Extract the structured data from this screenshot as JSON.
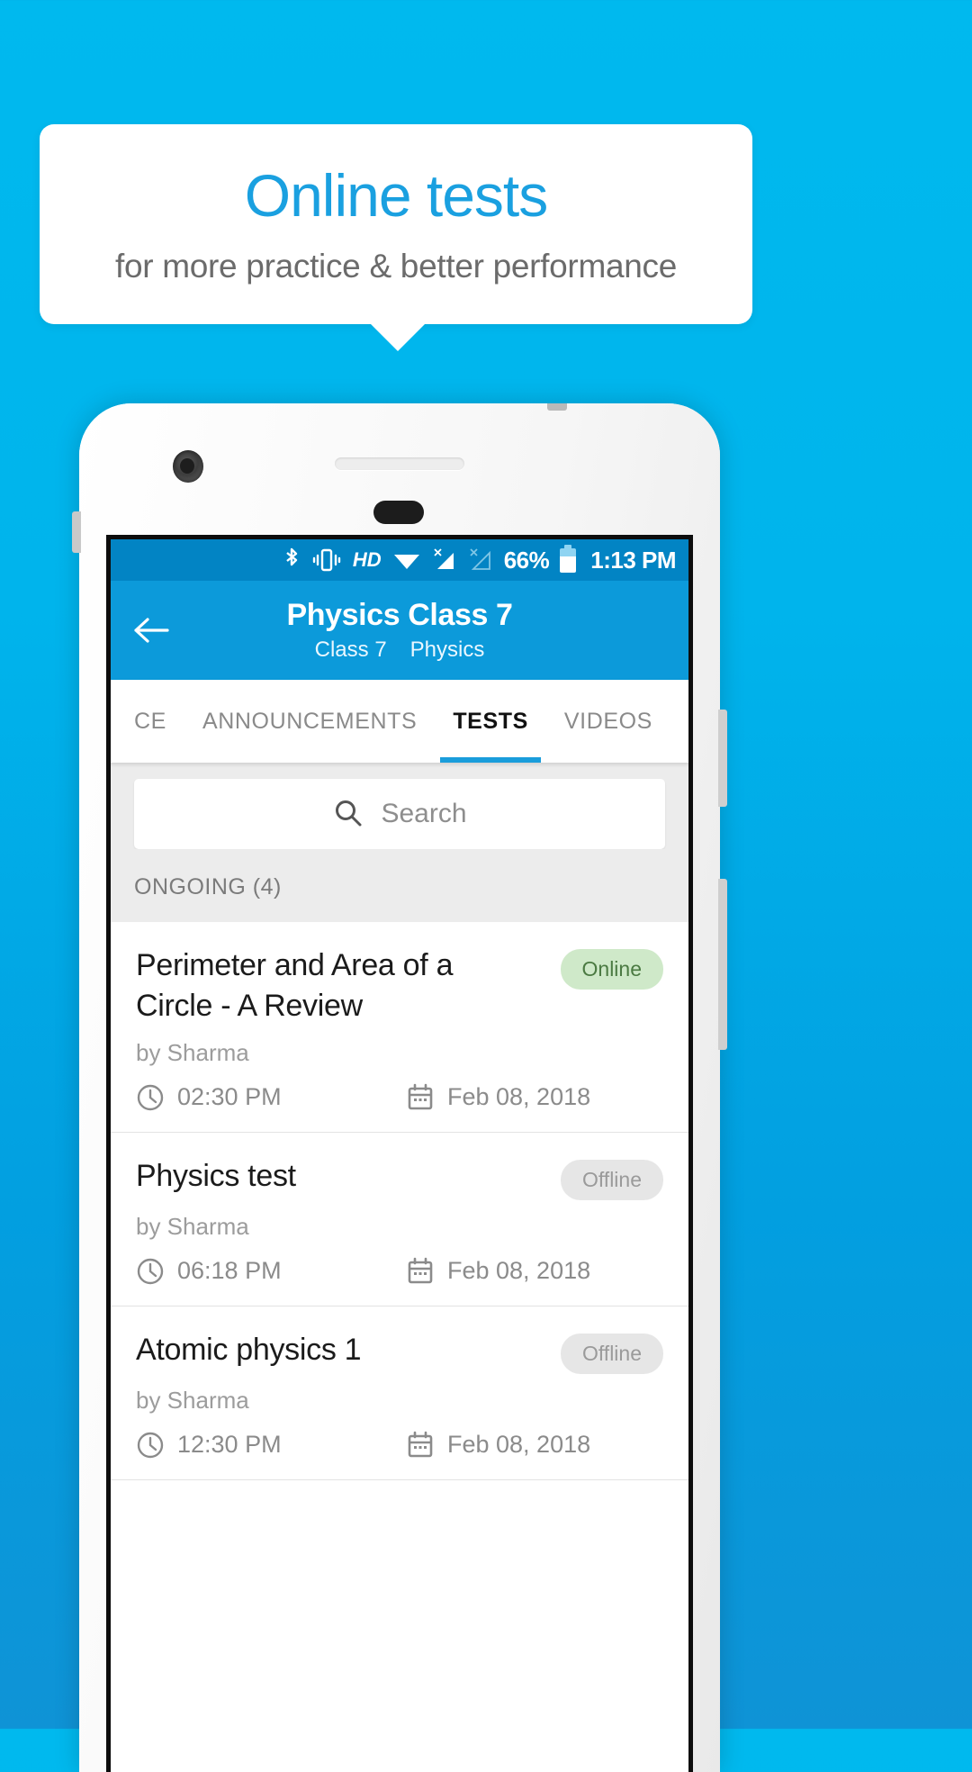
{
  "promo": {
    "title": "Online tests",
    "subtitle": "for more practice & better performance",
    "title_color": "#1aa0e0",
    "subtitle_color": "#6b6b6b",
    "background_color": "#00b4ec"
  },
  "status_bar": {
    "bluetooth_icon": "bluetooth-icon",
    "vibrate_icon": "vibrate-icon",
    "hd_label": "HD",
    "wifi_icon": "wifi-icon",
    "signal_one_icon": "signal-no-sim-1-icon",
    "signal_two_icon": "signal-no-sim-2-icon",
    "battery_percent": "66%",
    "battery_icon": "battery-icon",
    "time": "1:13 PM",
    "background_color": "#0284c4"
  },
  "app_bar": {
    "back_icon": "back-arrow-icon",
    "title": "Physics Class 7",
    "subtitle_class": "Class 7",
    "subtitle_subject": "Physics",
    "background_color": "#0c9ada"
  },
  "tabs": {
    "items": [
      {
        "label": "CE",
        "active": false
      },
      {
        "label": "ANNOUNCEMENTS",
        "active": false
      },
      {
        "label": "TESTS",
        "active": true
      },
      {
        "label": "VIDEOS",
        "active": false
      }
    ],
    "indicator_color": "#1a9ddb"
  },
  "search": {
    "icon": "search-icon",
    "placeholder": "Search",
    "value": ""
  },
  "section": {
    "header": "ONGOING (4)"
  },
  "tests": [
    {
      "title": "Perimeter and Area of a Circle - A Review",
      "badge": "Online",
      "badge_state": "online",
      "author": "by Sharma",
      "time": "02:30 PM",
      "date": "Feb 08, 2018",
      "clock_icon": "clock-icon",
      "calendar_icon": "calendar-icon"
    },
    {
      "title": "Physics test",
      "badge": "Offline",
      "badge_state": "offline",
      "author": "by Sharma",
      "time": "06:18 PM",
      "date": "Feb 08, 2018",
      "clock_icon": "clock-icon",
      "calendar_icon": "calendar-icon"
    },
    {
      "title": "Atomic physics 1",
      "badge": "Offline",
      "badge_state": "offline",
      "author": "by Sharma",
      "time": "12:30 PM",
      "date": "Feb 08, 2018",
      "clock_icon": "clock-icon",
      "calendar_icon": "calendar-icon"
    }
  ]
}
